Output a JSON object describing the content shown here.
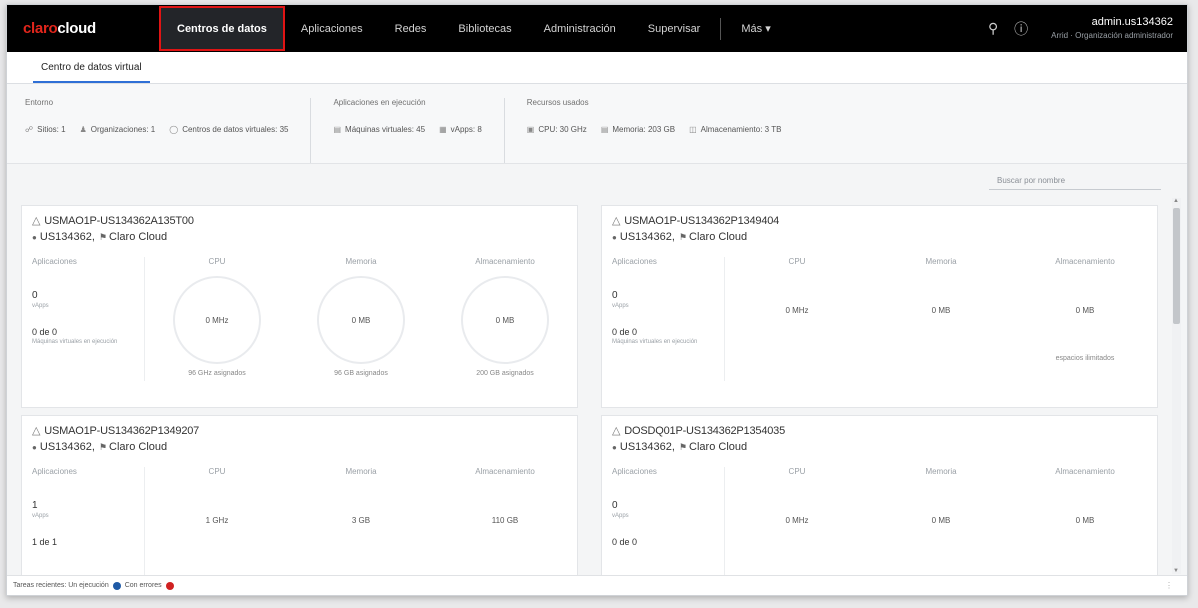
{
  "nav": {
    "brand_a": "claro",
    "brand_b": "cloud",
    "items": [
      "Centros de datos",
      "Aplicaciones",
      "Redes",
      "Bibliotecas",
      "Administración",
      "Supervisar",
      "Más"
    ],
    "more_chevron": "▾",
    "user_name": "admin.us134362",
    "user_org": "Arrid · Organización administrador"
  },
  "subtab": "Centro de datos virtual",
  "summary": {
    "groups": [
      {
        "title": "Entorno",
        "items": [
          {
            "icon": "site-icon",
            "text": "Sitios: 1"
          },
          {
            "icon": "org-icon",
            "text": "Organizaciones: 1"
          },
          {
            "icon": "vdc-icon",
            "text": "Centros de datos virtuales: 35"
          }
        ]
      },
      {
        "title": "Aplicaciones en ejecución",
        "items": [
          {
            "icon": "vm-icon",
            "text": "Máquinas virtuales: 45"
          },
          {
            "icon": "vapp-icon",
            "text": "vApps: 8"
          }
        ]
      },
      {
        "title": "Recursos usados",
        "items": [
          {
            "icon": "cpu-icon",
            "text": "CPU: 30 GHz"
          },
          {
            "icon": "memory-icon",
            "text": "Memoria: 203 GB"
          },
          {
            "icon": "storage-icon",
            "text": "Almacenamiento: 3 TB"
          }
        ]
      }
    ]
  },
  "search_placeholder": "Buscar por nombre",
  "cards": [
    {
      "name": "USMAO1P-US134362A135T00",
      "org": "US134362",
      "site": "Claro Cloud",
      "labels": {
        "apps": "Aplicaciones",
        "cpu": "CPU",
        "mem": "Memoria",
        "storage": "Almacenamiento"
      },
      "apps_count": "0",
      "apps_sub": "vApps",
      "apps_of": "0 de 0",
      "apps_caption": "Máquinas virtuales en ejecución",
      "cpu": "0 MHz",
      "mem": "0 MB",
      "storage": "0 MB",
      "cpu_cap": "96 GHz asignados",
      "mem_cap": "96 GB asignados",
      "storage_cap": "200 GB asignados",
      "gauges": true
    },
    {
      "name": "USMAO1P-US134362P1349404",
      "org": "US134362",
      "site": "Claro Cloud",
      "labels": {
        "apps": "Aplicaciones",
        "cpu": "CPU",
        "mem": "Memoria",
        "storage": "Almacenamiento"
      },
      "apps_count": "0",
      "apps_sub": "vApps",
      "apps_of": "0 de 0",
      "apps_caption": "Máquinas virtuales en ejecución",
      "cpu": "0 MHz",
      "mem": "0 MB",
      "storage": "0 MB",
      "storage_cap": "espacios ilimitados",
      "gauges": false
    },
    {
      "name": "USMAO1P-US134362P1349207",
      "org": "US134362",
      "site": "Claro Cloud",
      "labels": {
        "apps": "Aplicaciones",
        "cpu": "CPU",
        "mem": "Memoria",
        "storage": "Almacenamiento"
      },
      "apps_count": "1",
      "apps_sub": "vApps",
      "apps_of": "1 de 1",
      "cpu": "1 GHz",
      "mem": "3 GB",
      "storage": "110 GB",
      "gauges": false
    },
    {
      "name": "DOSDQ01P-US134362P1354035",
      "org": "US134362",
      "site": "Claro Cloud",
      "labels": {
        "apps": "Aplicaciones",
        "cpu": "CPU",
        "mem": "Memoria",
        "storage": "Almacenamiento"
      },
      "apps_count": "0",
      "apps_sub": "vApps",
      "apps_of": "0 de 0",
      "cpu": "0 MHz",
      "mem": "0 MB",
      "storage": "0 MB",
      "gauges": false
    }
  ],
  "footer": {
    "text": "Tareas recientes: Un ejecución",
    "running_count": "0",
    "failed_label": "Con errores",
    "failed_count": "0"
  },
  "colors": {
    "accent": "#2f6fd6",
    "brand_red": "#e2261c",
    "highlight": "#e01414"
  }
}
